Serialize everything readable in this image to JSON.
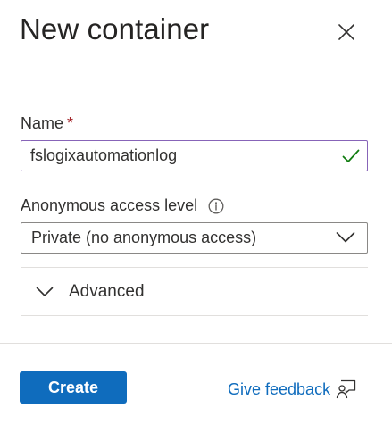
{
  "panel": {
    "title": "New container",
    "close_icon": "close-icon"
  },
  "name_field": {
    "label": "Name",
    "required_marker": "*",
    "value": "fslogixautomationlog",
    "valid_icon": "checkmark-icon",
    "valid_color": "#107c10"
  },
  "access_field": {
    "label": "Anonymous access level",
    "info_icon": "info-icon",
    "selected": "Private (no anonymous access)",
    "dropdown_icon": "chevron-down-icon"
  },
  "advanced": {
    "label": "Advanced",
    "expanded": false,
    "icon": "chevron-down-icon"
  },
  "footer": {
    "create_label": "Create",
    "feedback_label": "Give feedback",
    "feedback_icon": "feedback-person-icon",
    "accent_color": "#0f6cbd"
  }
}
